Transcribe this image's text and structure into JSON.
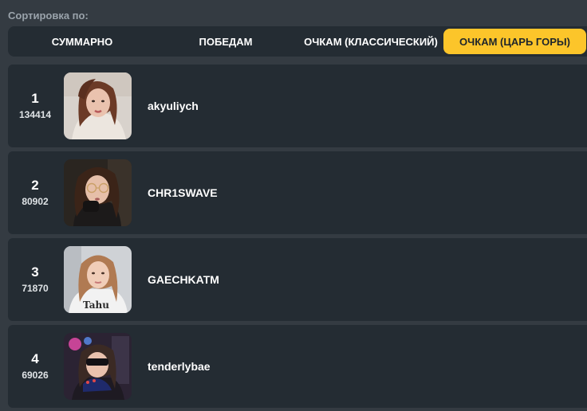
{
  "sort": {
    "label": "Сортировка по:",
    "tabs": [
      {
        "label": "СУММАРНО",
        "active": false
      },
      {
        "label": "ПОБЕДАМ",
        "active": false
      },
      {
        "label": "ОЧКАМ (КЛАССИЧЕСКИЙ)",
        "active": false
      },
      {
        "label": "ОЧКАМ (ЦАРЬ ГОРЫ)",
        "active": true
      }
    ]
  },
  "colors": {
    "background": "#343b42",
    "panel": "#242c33",
    "accent": "#fcc52a"
  },
  "leaderboard": [
    {
      "rank": "1",
      "score": "134414",
      "username": "akyuliych"
    },
    {
      "rank": "2",
      "score": "80902",
      "username": "CHR1SWAVE"
    },
    {
      "rank": "3",
      "score": "71870",
      "username": "GAECHKATM"
    },
    {
      "rank": "4",
      "score": "69026",
      "username": "tenderlybae"
    }
  ]
}
